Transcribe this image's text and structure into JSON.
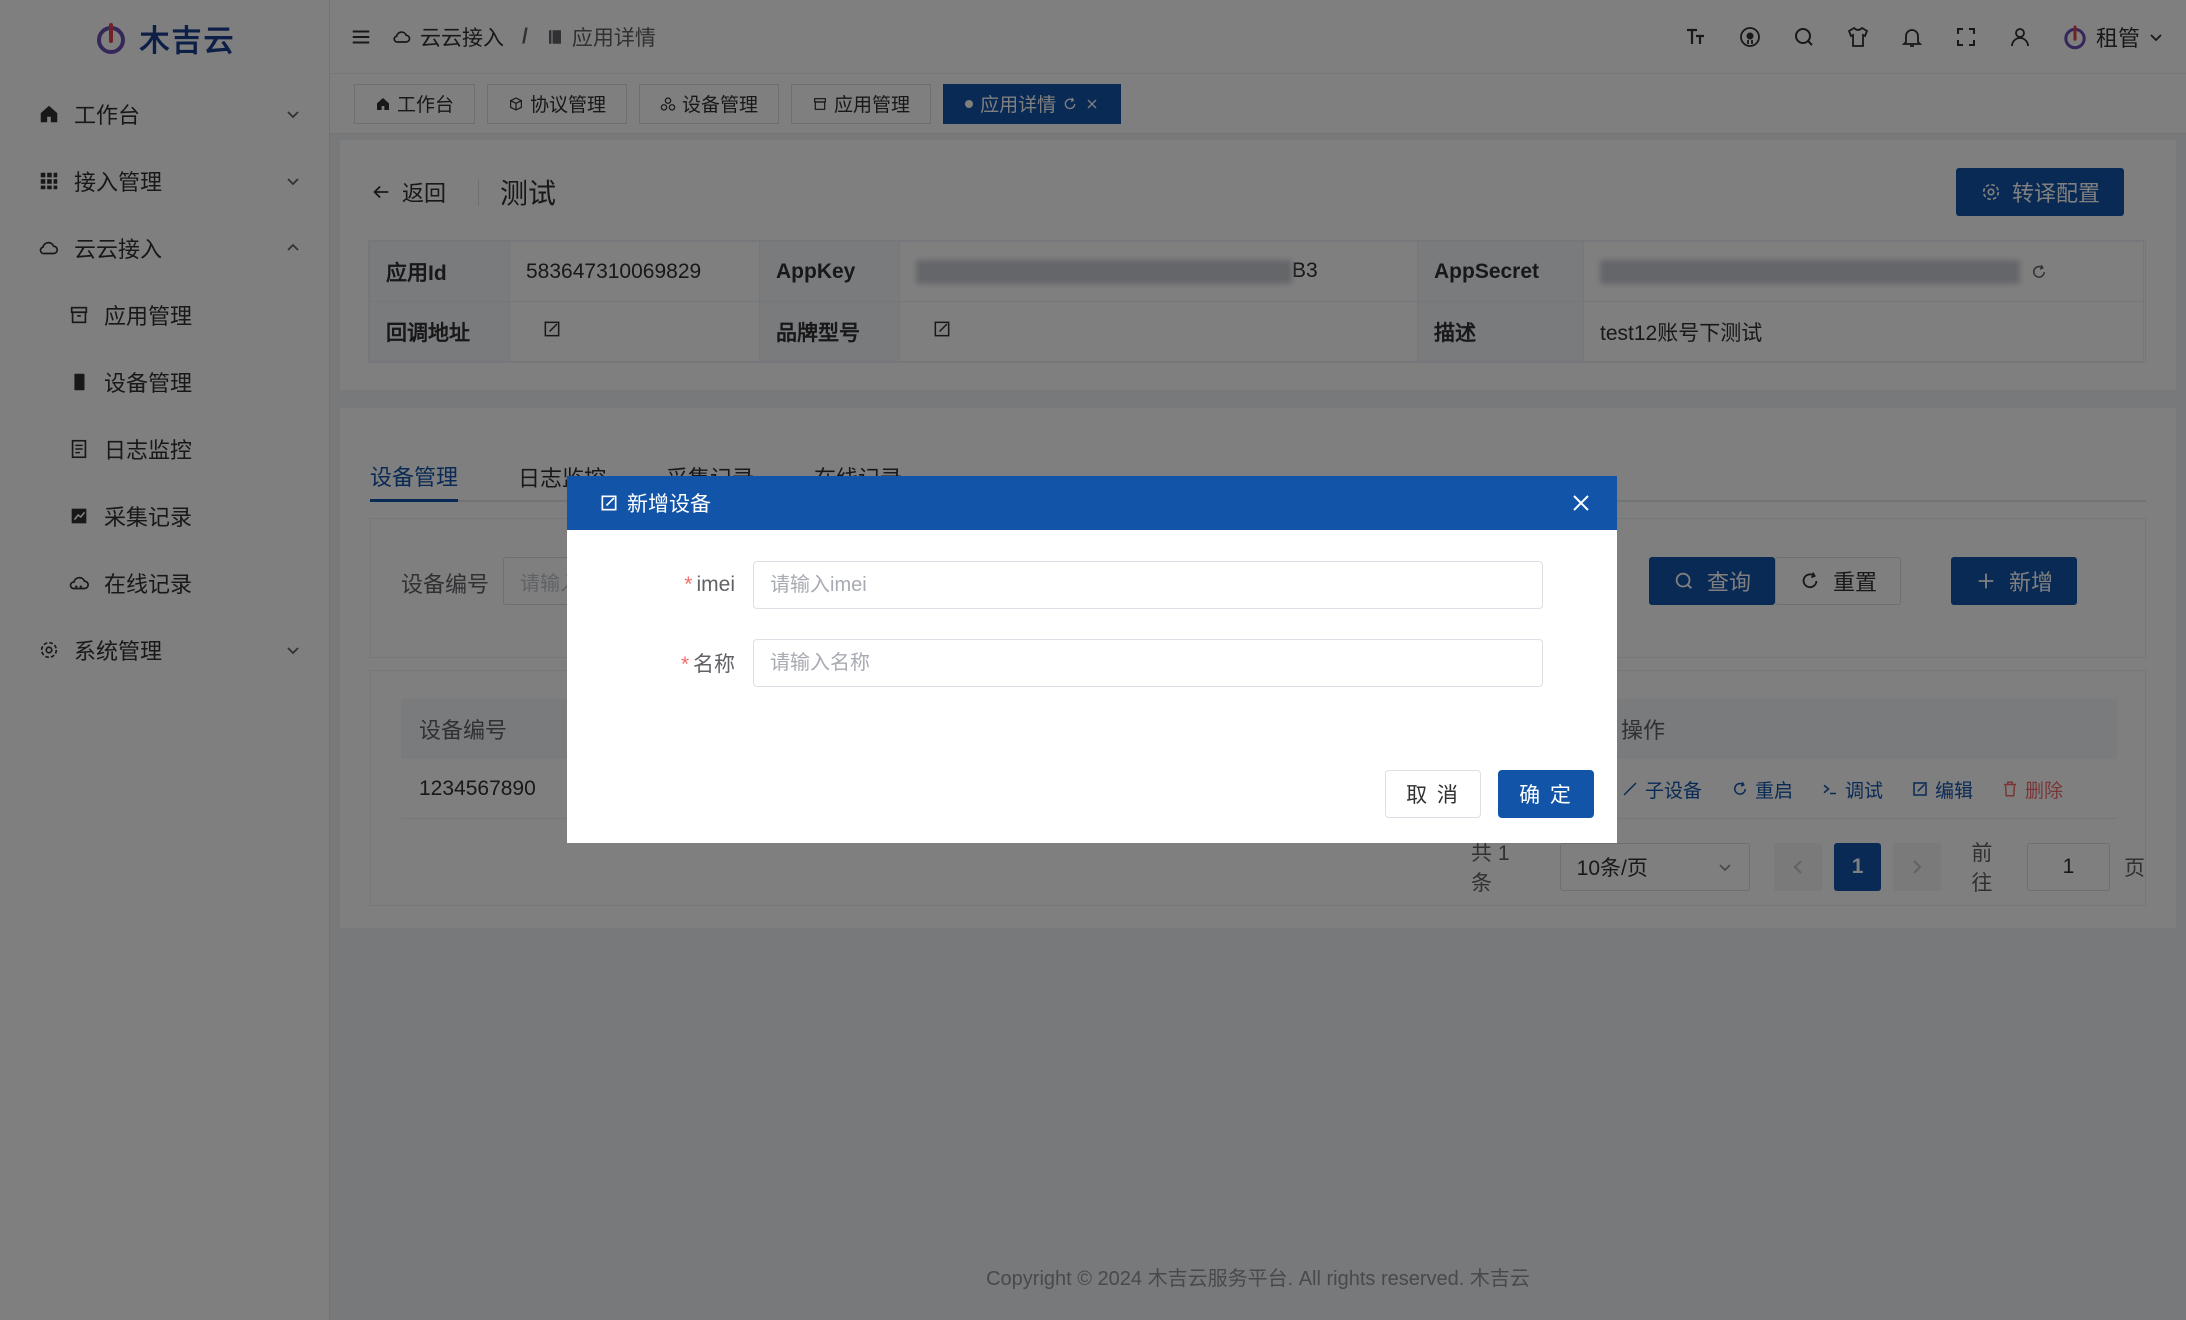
{
  "brand": {
    "name": "木吉云",
    "accent": "#1254a8"
  },
  "sidebar": {
    "items": [
      {
        "label": "工作台",
        "icon": "home-icon"
      },
      {
        "label": "接入管理",
        "icon": "grid-icon"
      },
      {
        "label": "云云接入",
        "icon": "cloud-icon"
      },
      {
        "label": "应用管理",
        "icon": "archive-icon"
      },
      {
        "label": "设备管理",
        "icon": "device-icon"
      },
      {
        "label": "日志监控",
        "icon": "document-icon"
      },
      {
        "label": "采集记录",
        "icon": "chart-icon"
      },
      {
        "label": "在线记录",
        "icon": "cloud-online-icon"
      },
      {
        "label": "系统管理",
        "icon": "gear-icon"
      }
    ]
  },
  "header": {
    "breadcrumb": [
      "云云接入",
      "应用详情"
    ],
    "separator": "/",
    "user": "租管"
  },
  "tags": [
    {
      "label": "工作台"
    },
    {
      "label": "协议管理"
    },
    {
      "label": "设备管理"
    },
    {
      "label": "应用管理"
    },
    {
      "label": "应用详情"
    }
  ],
  "detail": {
    "back_label": "返回",
    "title": "测试",
    "translate_button": "转译配置",
    "app_id_label": "应用Id",
    "app_id": "583647310069829",
    "app_key_label": "AppKey",
    "app_key_suffix": "B3",
    "app_secret_label": "AppSecret",
    "callback_label": "回调地址",
    "brand_model_label": "品牌型号",
    "desc_label": "描述",
    "desc": "test12账号下测试"
  },
  "tabs": [
    "设备管理",
    "日志监控",
    "采集记录",
    "在线记录"
  ],
  "search": {
    "label": "设备编号",
    "placeholder": "请输入",
    "query_button": "查询",
    "reset_button": "重置",
    "add_button": "新增"
  },
  "table": {
    "col_device_no": "设备编号",
    "col_ops": "操作",
    "rows": [
      {
        "device_no": "1234567890"
      }
    ],
    "ops": {
      "sub": "子设备",
      "restart": "重启",
      "debug": "调试",
      "edit": "编辑",
      "delete": "删除"
    }
  },
  "pager": {
    "total": "共 1 条",
    "page_size": "10条/页",
    "current": "1",
    "goto_label": "前往",
    "goto_value": "1",
    "page_unit": "页"
  },
  "footer": "Copyright © 2024 木吉云服务平台. All rights reserved. 木吉云",
  "dialog": {
    "title": "新增设备",
    "imei_label": "imei",
    "imei_placeholder": "请输入imei",
    "name_label": "名称",
    "name_placeholder": "请输入名称",
    "cancel": "取 消",
    "confirm": "确 定"
  }
}
